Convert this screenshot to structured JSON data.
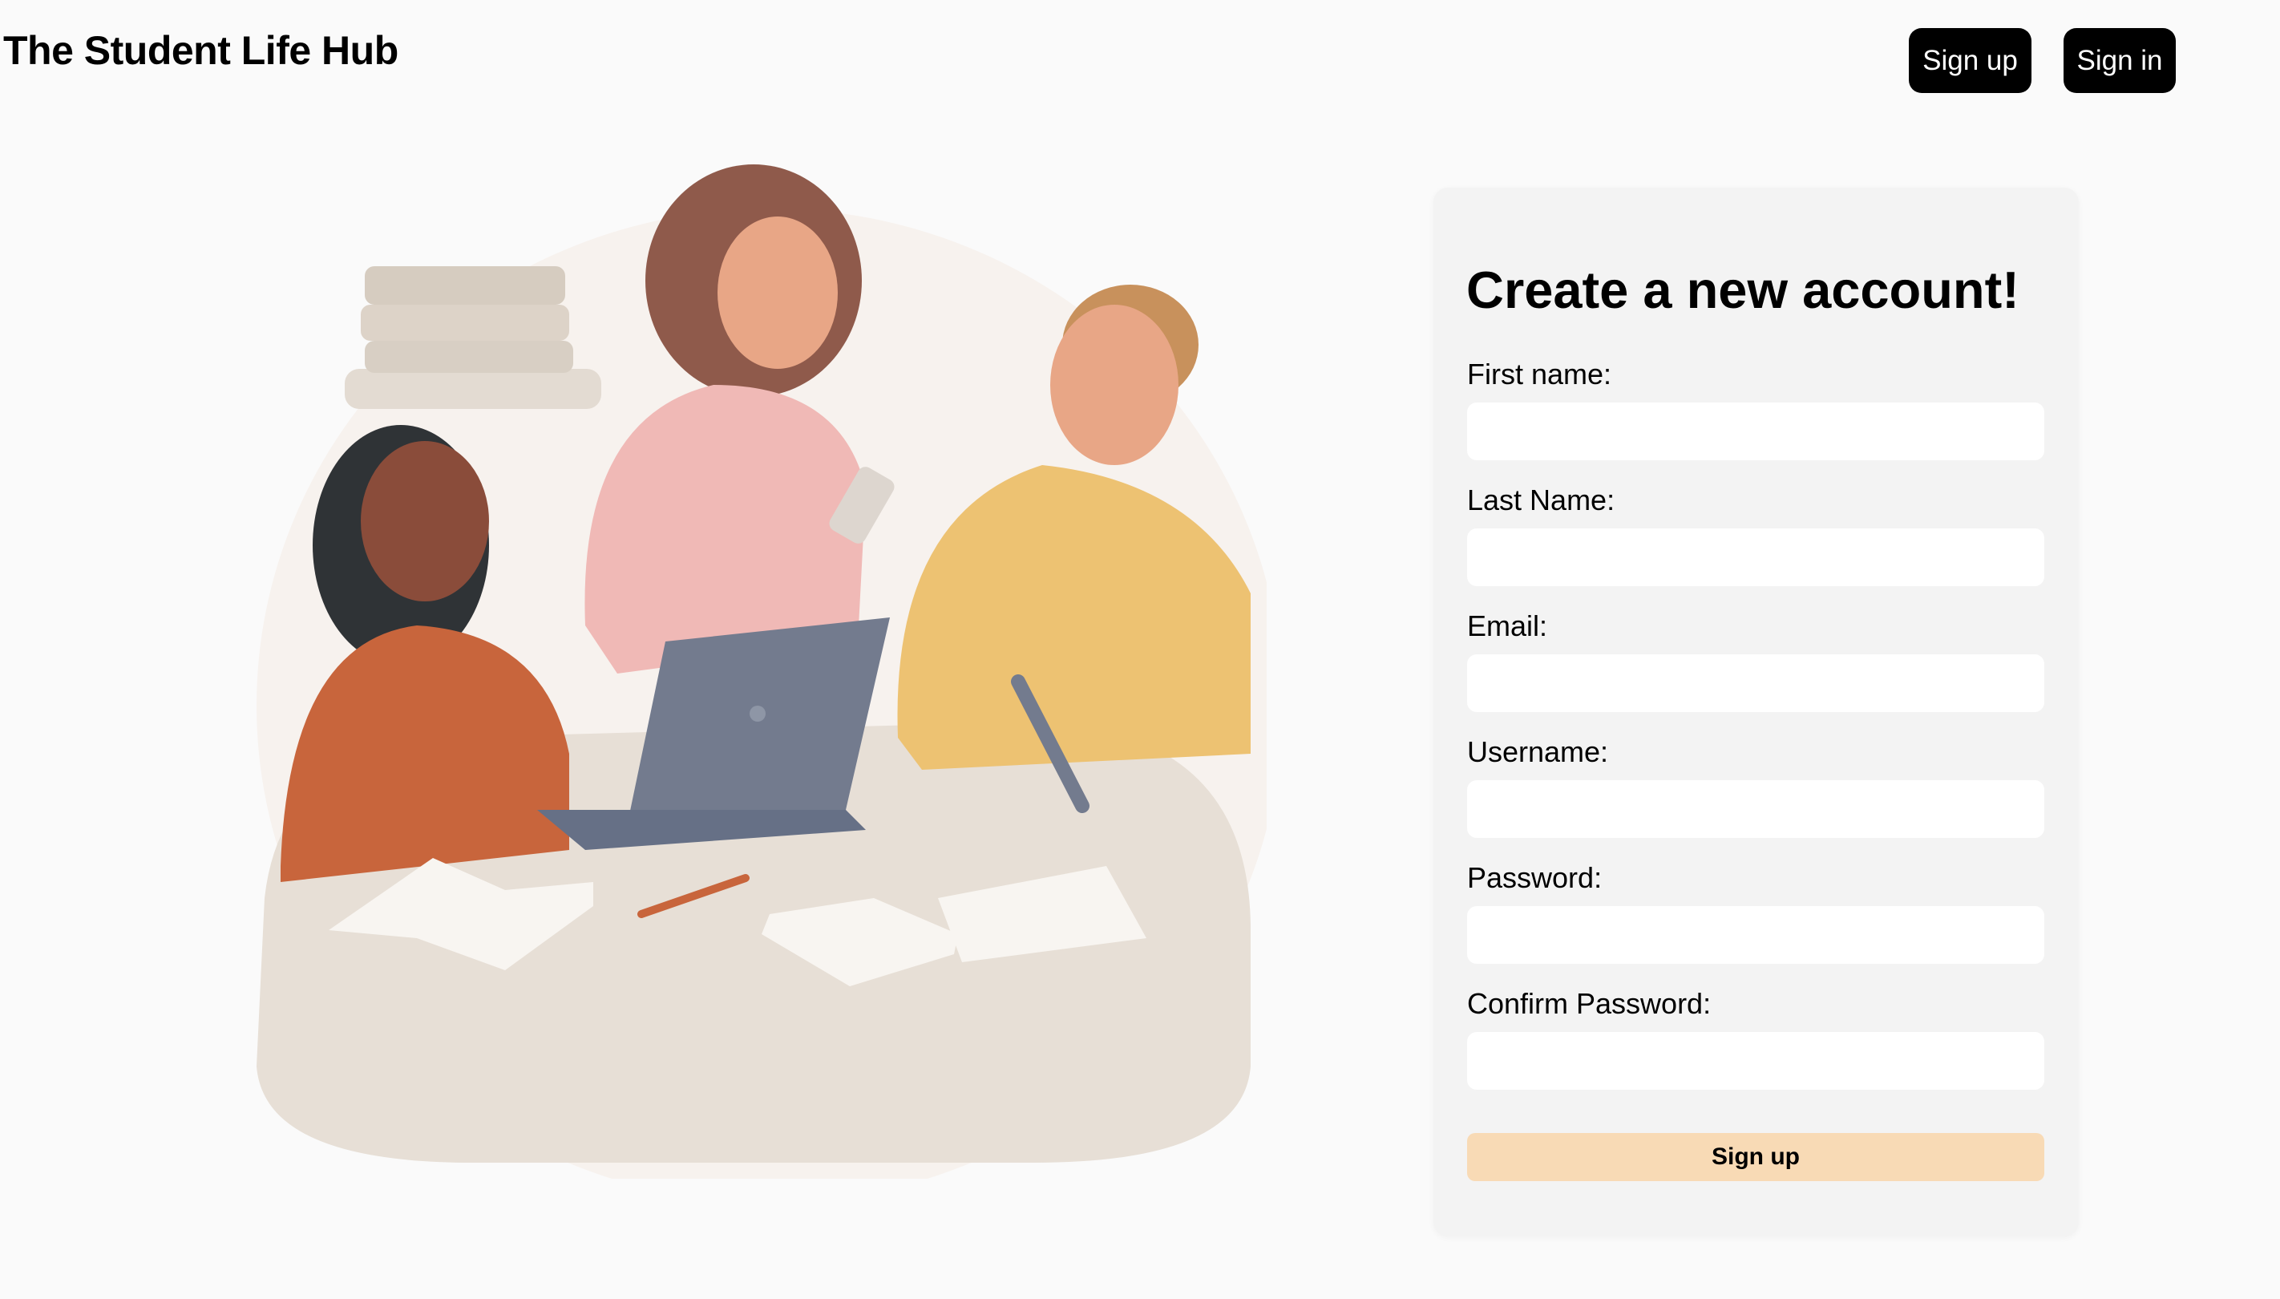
{
  "header": {
    "brand": "The Student Life Hub",
    "signup_label": "Sign up",
    "signin_label": "Sign in"
  },
  "form": {
    "title": "Create a new account!",
    "fields": [
      {
        "label": "First name:",
        "value": ""
      },
      {
        "label": "Last Name:",
        "value": ""
      },
      {
        "label": "Email:",
        "value": ""
      },
      {
        "label": "Username:",
        "value": ""
      },
      {
        "label": "Password:",
        "value": ""
      },
      {
        "label": "Confirm Password:",
        "value": ""
      }
    ],
    "submit_label": "Sign up"
  },
  "colors": {
    "page_background": "#fafafa",
    "card_background": "#f3f3f3",
    "nav_button": "#000000",
    "submit_button": "#f8dab5"
  },
  "illustration": {
    "icon": "students-studying-illustration"
  }
}
